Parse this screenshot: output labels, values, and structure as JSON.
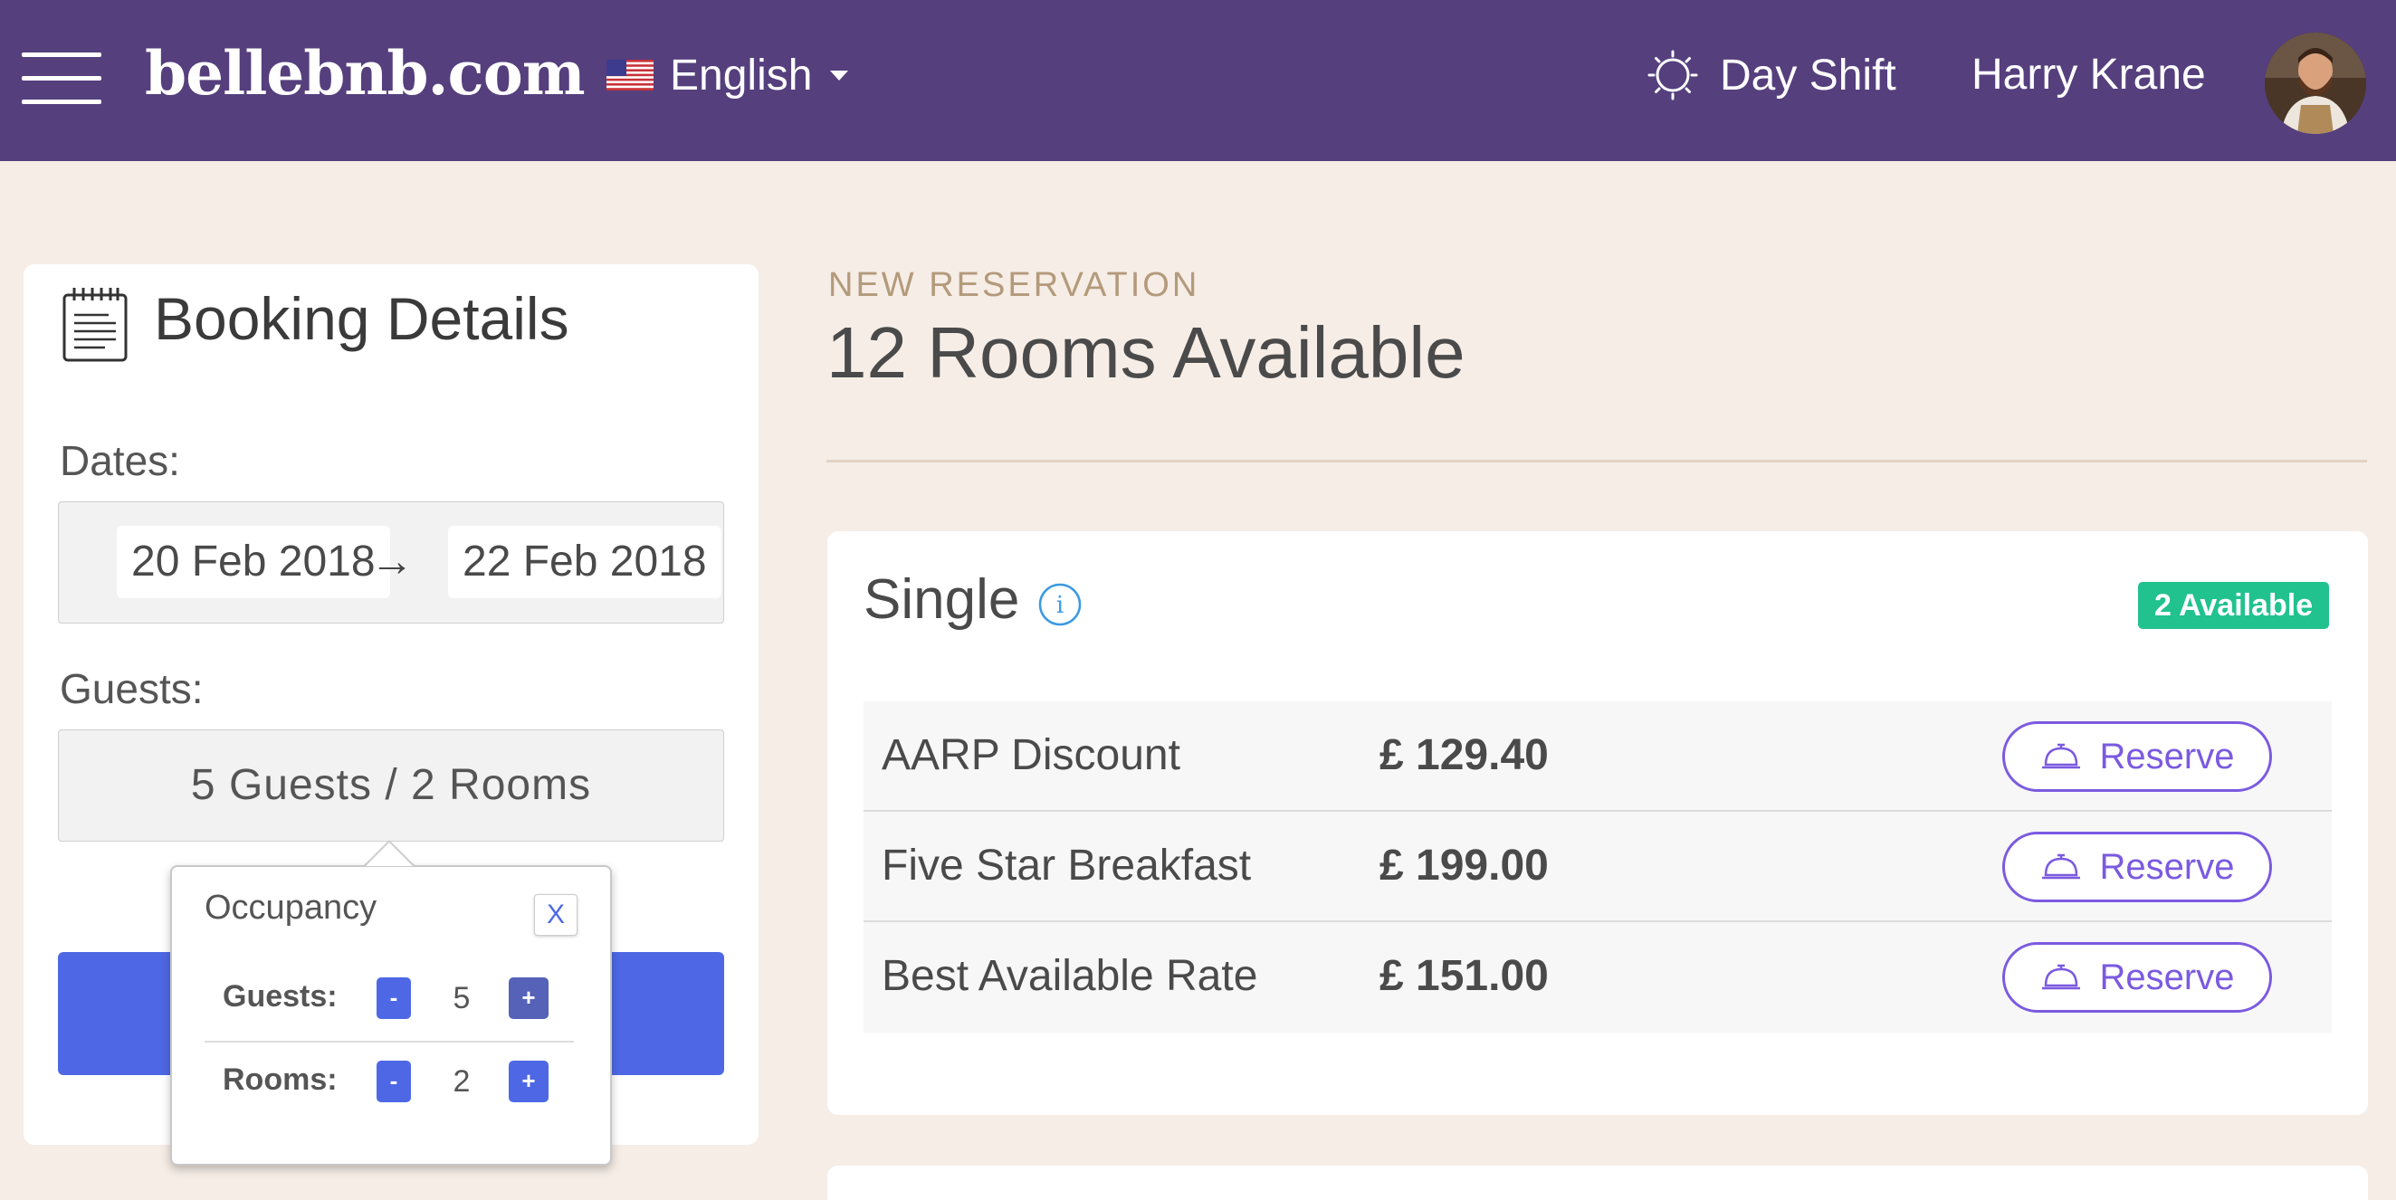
{
  "header": {
    "brand": "bellebnb.com",
    "language": "English",
    "shift": "Day Shift",
    "user_name": "Harry Krane",
    "background_color": "#553f7d"
  },
  "icons": {
    "menu": "hamburger-menu-icon",
    "flag": "us-flag-icon",
    "language_dropdown": "chevron-down-icon",
    "shift": "sun-icon",
    "booking": "notepad-icon",
    "info": "info-icon",
    "reserve": "service-bell-icon"
  },
  "booking": {
    "title": "Booking Details",
    "dates_label": "Dates:",
    "start_date": "20 Feb 2018",
    "arrow": "→",
    "end_date": "22 Feb 2018",
    "guests_label": "Guests:",
    "guests_summary": "5 Guests / 2 Rooms"
  },
  "occupancy": {
    "title": "Occupancy",
    "close_label": "X",
    "guests_label": "Guests:",
    "guests_value": "5",
    "rooms_label": "Rooms:",
    "rooms_value": "2",
    "minus_label": "-",
    "plus_label": "+"
  },
  "main": {
    "eyebrow": "NEW RESERVATION",
    "title": "12 Rooms Available"
  },
  "rooms": [
    {
      "name": "Single",
      "availability": "2 Available",
      "rates": [
        {
          "name": "AARP Discount",
          "price": "£ 129.40",
          "action": "Reserve"
        },
        {
          "name": "Five Star Breakfast",
          "price": "£ 199.00",
          "action": "Reserve"
        },
        {
          "name": "Best Available Rate",
          "price": "£ 151.00",
          "action": "Reserve"
        }
      ]
    }
  ],
  "colors": {
    "accent_blue": "#4e68e5",
    "reserve_purple": "#7b5ae0",
    "available_green": "#21c28e",
    "page_background": "#f6ede6"
  }
}
